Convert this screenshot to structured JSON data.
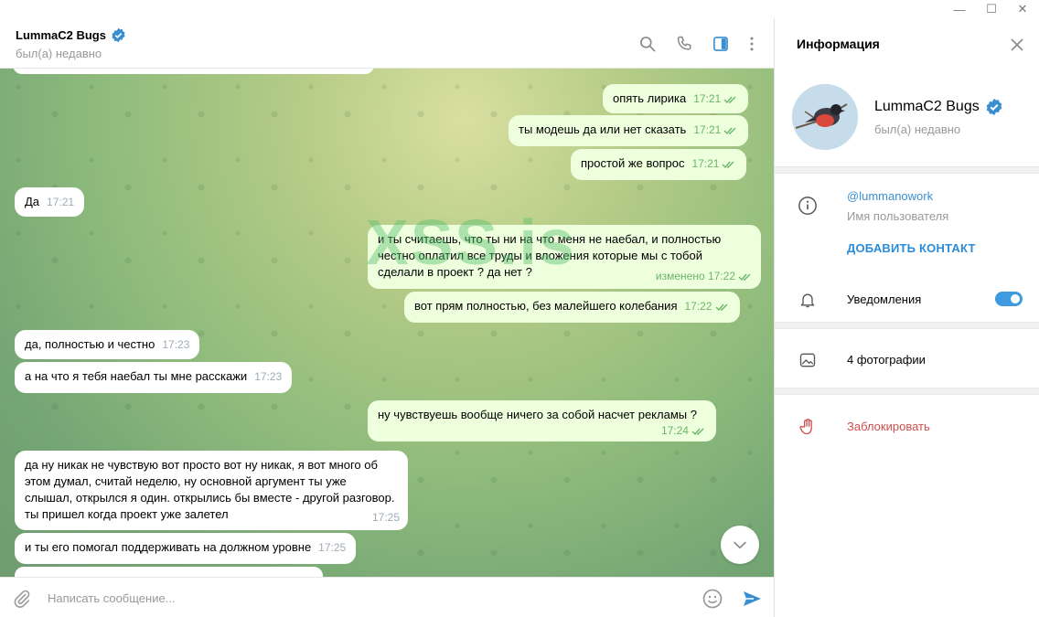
{
  "window": {
    "minimize": "—",
    "maximize": "☐",
    "close": "✕"
  },
  "chat": {
    "title": "LummaC2 Bugs",
    "status": "был(а) недавно",
    "composer_placeholder": "Написать сообщение...",
    "watermark": "XSS.is"
  },
  "messages": [
    {
      "dir": "out",
      "text": "опять лирика",
      "time": "17:21"
    },
    {
      "dir": "out",
      "text": "ты модешь да или нет сказать",
      "time": "17:21"
    },
    {
      "dir": "out",
      "text": "простой же вопрос",
      "time": "17:21"
    },
    {
      "dir": "in",
      "text": "Да",
      "time": "17:21"
    },
    {
      "dir": "out",
      "text": "и ты считаешь, что ты ни на что меня не наебал, и полностью честно оплатил все труды и вложения которые мы с тобой сделали в проект ? да нет ?",
      "time": "изменено 17:22"
    },
    {
      "dir": "out",
      "text": "вот прям полностью, без малейшего колебания",
      "time": "17:22"
    },
    {
      "dir": "in",
      "text": "да, полностью и честно",
      "time": "17:23"
    },
    {
      "dir": "in",
      "text": "а на что я тебя наебал ты мне расскажи",
      "time": "17:23"
    },
    {
      "dir": "out",
      "text": "ну чувствуешь вообще ничего за собой насчет рекламы ?",
      "time": "17:24"
    },
    {
      "dir": "in",
      "text": "да ну никак не чувствую вот просто вот ну никак, я вот много об этом думал, считай неделю, ну основной аргумент ты уже слышал, открылся я один. открылись бы вместе - другой разговор. ты пришел когда проект уже залетел",
      "time": "17:25"
    },
    {
      "dir": "in",
      "text": "и ты его помогал поддерживать на должном уровне",
      "time": "17:25"
    }
  ],
  "info": {
    "title": "Информация",
    "name": "LummaC2 Bugs",
    "status": "был(а) недавно",
    "username": "@lummanowork",
    "username_caption": "Имя пользователя",
    "add_contact": "ДОБАВИТЬ КОНТАКТ",
    "notifications": "Уведомления",
    "notifications_on": true,
    "photos": "4 фотографии",
    "block": "Заблокировать"
  },
  "colors": {
    "accent": "#3a8fd1",
    "outgoing_bubble": "#eeffde",
    "danger": "#d14e4e"
  },
  "icons": [
    "search-icon",
    "phone-icon",
    "sidebar-toggle-icon",
    "more-icon",
    "close-icon",
    "info-icon",
    "bell-icon",
    "photo-icon",
    "block-hand-icon",
    "attach-icon",
    "emoji-icon",
    "send-icon",
    "chevron-down-icon",
    "verified-badge-icon",
    "double-check-icon"
  ]
}
